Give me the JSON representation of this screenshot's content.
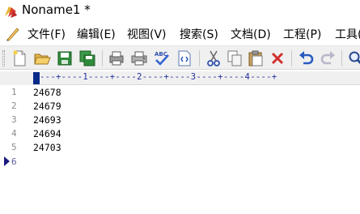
{
  "window": {
    "title": "Noname1 *"
  },
  "menu": {
    "items": [
      {
        "label": "文件(F)"
      },
      {
        "label": "编辑(E)"
      },
      {
        "label": "视图(V)"
      },
      {
        "label": "搜索(S)"
      },
      {
        "label": "文档(D)"
      },
      {
        "label": "工程(P)"
      },
      {
        "label": "工具("
      }
    ]
  },
  "toolbar": {
    "buttons": [
      {
        "icon": "new-file-icon"
      },
      {
        "icon": "open-folder-icon"
      },
      {
        "icon": "save-icon"
      },
      {
        "icon": "save-all-icon"
      },
      {
        "icon": "print-preview-icon"
      },
      {
        "icon": "print-icon"
      },
      {
        "icon": "spell-check-icon"
      },
      {
        "icon": "html-preview-icon"
      },
      {
        "icon": "cut-icon"
      },
      {
        "icon": "copy-icon"
      },
      {
        "icon": "paste-icon"
      },
      {
        "icon": "delete-icon"
      },
      {
        "icon": "undo-icon"
      },
      {
        "icon": "redo-icon"
      },
      {
        "icon": "find-icon"
      }
    ]
  },
  "ruler": {
    "text": "---+----1----+----2----+----3----+----4----+"
  },
  "editor": {
    "line_numbers": [
      "1",
      "2",
      "3",
      "4",
      "5",
      "6"
    ],
    "lines": [
      "24678",
      "24679",
      "24693",
      "24694",
      "24703",
      ""
    ],
    "current_line": 6
  }
}
